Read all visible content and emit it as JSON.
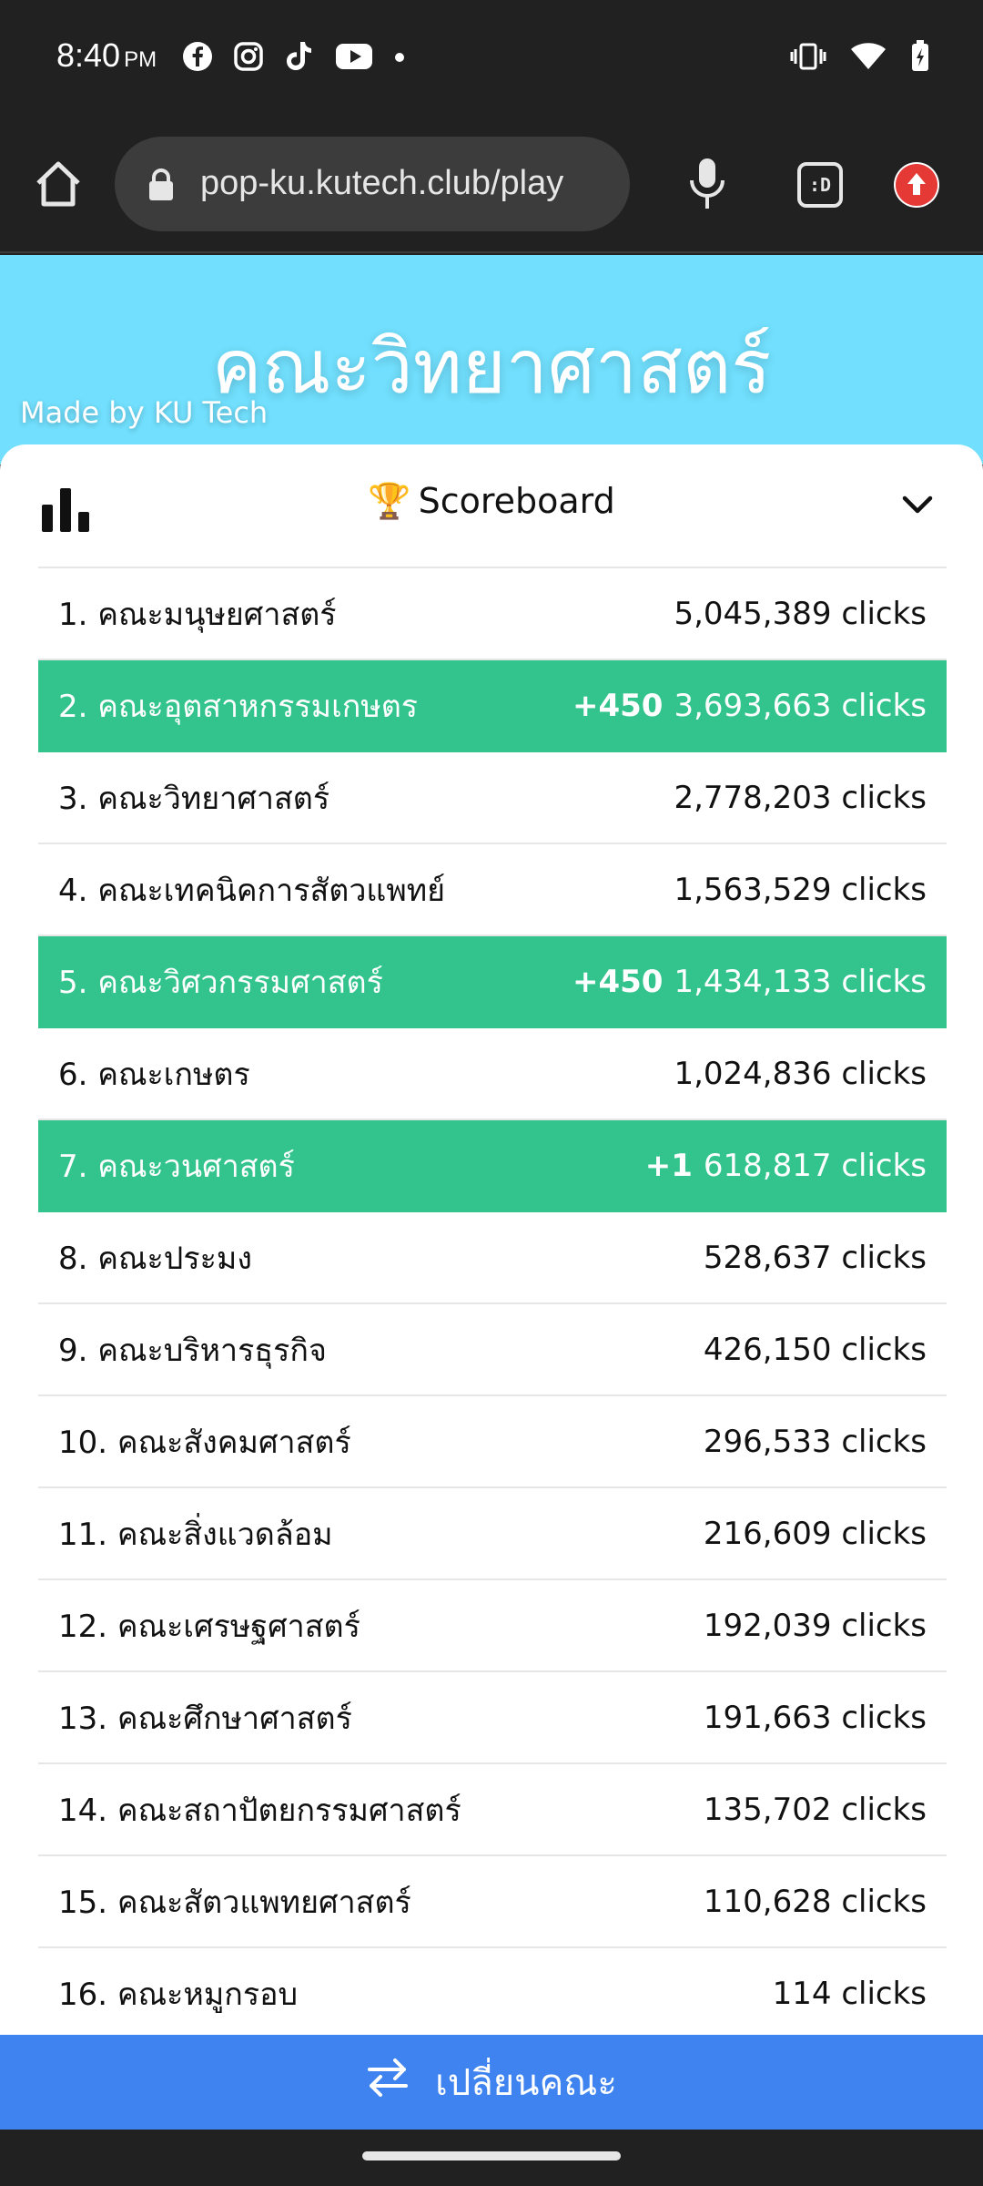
{
  "status_bar": {
    "time": "8:40",
    "ampm": "PM",
    "left_icons": [
      "facebook-icon",
      "instagram-icon",
      "tiktok-icon",
      "youtube-icon",
      "dot-icon"
    ],
    "right_icons": [
      "vibrate-icon",
      "wifi-icon",
      "battery-charging-icon"
    ]
  },
  "browser": {
    "url": "pop-ku.kutech.club/play",
    "tab_switcher_label": ":D"
  },
  "header": {
    "title": "คณะวิทยาศาสตร์",
    "credit": "Made by KU Tech",
    "background_color": "#71dffd"
  },
  "scoreboard": {
    "trophy": "🏆",
    "title": "Scoreboard",
    "highlight_color": "#33c48d",
    "rows": [
      {
        "rank_name": "1. คณะมนุษยศาสตร์",
        "delta": "",
        "clicks": "5,045,389 clicks",
        "highlighted": false
      },
      {
        "rank_name": "2. คณะอุตสาหกรรมเกษตร",
        "delta": "+450",
        "clicks": "3,693,663 clicks",
        "highlighted": true
      },
      {
        "rank_name": "3. คณะวิทยาศาสตร์",
        "delta": "",
        "clicks": "2,778,203 clicks",
        "highlighted": false
      },
      {
        "rank_name": "4. คณะเทคนิคการสัตวแพทย์",
        "delta": "",
        "clicks": "1,563,529 clicks",
        "highlighted": false
      },
      {
        "rank_name": "5. คณะวิศวกรรมศาสตร์",
        "delta": "+450",
        "clicks": "1,434,133 clicks",
        "highlighted": true
      },
      {
        "rank_name": "6. คณะเกษตร",
        "delta": "",
        "clicks": "1,024,836 clicks",
        "highlighted": false
      },
      {
        "rank_name": "7. คณะวนศาสตร์",
        "delta": "+1",
        "clicks": "618,817 clicks",
        "highlighted": true
      },
      {
        "rank_name": "8. คณะประมง",
        "delta": "",
        "clicks": "528,637 clicks",
        "highlighted": false
      },
      {
        "rank_name": "9. คณะบริหารธุรกิจ",
        "delta": "",
        "clicks": "426,150 clicks",
        "highlighted": false
      },
      {
        "rank_name": "10. คณะสังคมศาสตร์",
        "delta": "",
        "clicks": "296,533 clicks",
        "highlighted": false
      },
      {
        "rank_name": "11. คณะสิ่งแวดล้อม",
        "delta": "",
        "clicks": "216,609 clicks",
        "highlighted": false
      },
      {
        "rank_name": "12. คณะเศรษฐศาสตร์",
        "delta": "",
        "clicks": "192,039 clicks",
        "highlighted": false
      },
      {
        "rank_name": "13. คณะศึกษาศาสตร์",
        "delta": "",
        "clicks": "191,663 clicks",
        "highlighted": false
      },
      {
        "rank_name": "14. คณะสถาปัตยกรรมศาสตร์",
        "delta": "",
        "clicks": "135,702 clicks",
        "highlighted": false
      },
      {
        "rank_name": "15. คณะสัตวแพทยศาสตร์",
        "delta": "",
        "clicks": "110,628 clicks",
        "highlighted": false
      },
      {
        "rank_name": "16. คณะหมูกรอบ",
        "delta": "",
        "clicks": "114 clicks",
        "highlighted": false
      }
    ]
  },
  "footer": {
    "switch_label": "เปลี่ยนคณะ",
    "button_color": "#3f83f0"
  }
}
